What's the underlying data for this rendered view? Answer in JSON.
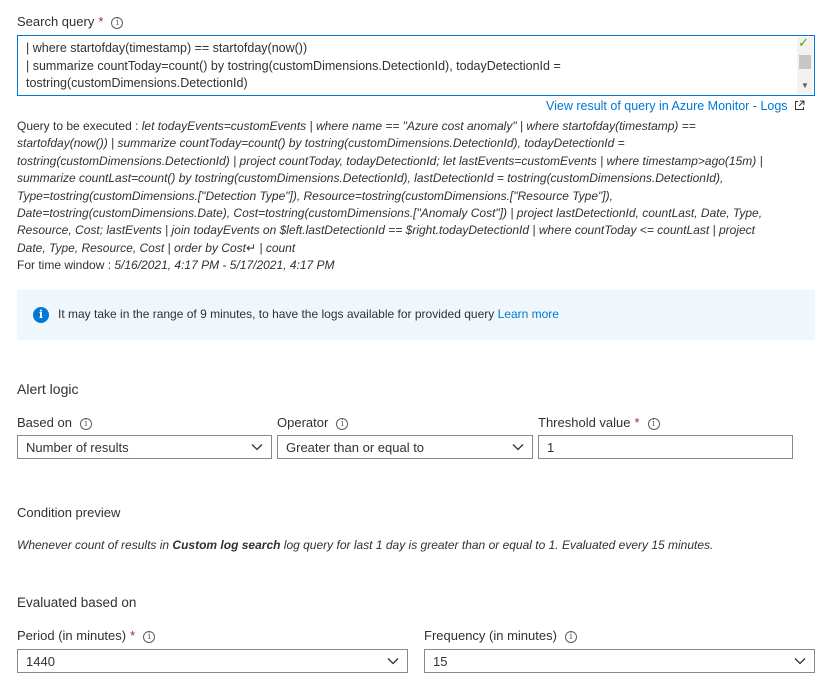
{
  "search_query": {
    "label": "Search query",
    "required_mark": "*",
    "lines": [
      "| where startofday(timestamp) == startofday(now())",
      "| summarize countToday=count() by tostring(customDimensions.DetectionId), todayDetectionId =",
      "tostring(customDimensions.DetectionId)"
    ],
    "view_result_link": "View result of query in Azure Monitor - Logs"
  },
  "query_to_execute": {
    "prefix": "Query to be executed : ",
    "lines": [
      "let todayEvents=customEvents | where name == \"Azure cost anomaly\" | where startofday(timestamp) ==",
      "startofday(now()) | summarize countToday=count() by tostring(customDimensions.DetectionId), todayDetectionId =",
      "tostring(customDimensions.DetectionId) | project countToday, todayDetectionId; let lastEvents=customEvents | where timestamp>ago(15m) |",
      "summarize countLast=count() by tostring(customDimensions.DetectionId), lastDetectionId = tostring(customDimensions.DetectionId),",
      "Type=tostring(customDimensions.[\"Detection Type\"]), Resource=tostring(customDimensions.[\"Resource Type\"]),",
      "Date=tostring(customDimensions.Date), Cost=tostring(customDimensions.[\"Anomaly Cost\"]) | project lastDetectionId, countLast, Date, Type,",
      "Resource, Cost; lastEvents | join todayEvents on $left.lastDetectionId == $right.todayDetectionId | where countToday <= countLast | project",
      "Date, Type, Resource, Cost | order by Cost↵ | count"
    ],
    "time_window_label": "For time window : ",
    "time_window_value": "5/16/2021, 4:17 PM - 5/17/2021, 4:17 PM"
  },
  "info_bar": {
    "message": "It may take in the range of 9 minutes, to have the logs available for provided query",
    "learn_more": "Learn more"
  },
  "alert_logic": {
    "title": "Alert logic",
    "based_on_label": "Based on",
    "based_on_value": "Number of results",
    "operator_label": "Operator",
    "operator_value": "Greater than or equal to",
    "threshold_label": "Threshold value",
    "threshold_value": "1"
  },
  "condition_preview": {
    "title": "Condition preview",
    "text_before": "Whenever count of results in ",
    "bold": "Custom log search",
    "text_after": " log query for last 1 day is greater than or equal to 1. Evaluated every 15 minutes."
  },
  "evaluated": {
    "title": "Evaluated based on",
    "period_label": "Period (in minutes)",
    "period_value": "1440",
    "frequency_label": "Frequency (in minutes)",
    "frequency_value": "15"
  },
  "colors": {
    "accent": "#0078d4",
    "required": "#a4262c",
    "valid_check": "#57a300",
    "info_bg": "#eff6fc"
  },
  "icons": [
    "info-icon",
    "check-icon",
    "external-link-icon",
    "chevron-down-icon"
  ]
}
